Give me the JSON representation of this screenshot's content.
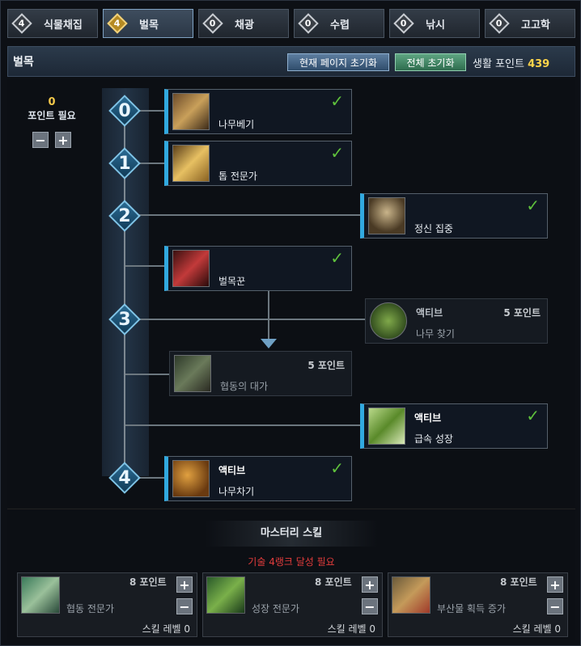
{
  "tabs": [
    {
      "num": "4",
      "label": "식물채집"
    },
    {
      "num": "4",
      "label": "벌목"
    },
    {
      "num": "0",
      "label": "채광"
    },
    {
      "num": "0",
      "label": "수렵"
    },
    {
      "num": "0",
      "label": "낚시"
    },
    {
      "num": "0",
      "label": "고고학"
    }
  ],
  "header": {
    "title": "벌목",
    "reset_page": "현재 페이지 초기화",
    "reset_all": "전체 초기화",
    "life_points_label": "생활 포인트",
    "life_points_value": "439"
  },
  "left": {
    "points": "0",
    "points_label": "포인트 필요",
    "minus": "−",
    "plus": "+"
  },
  "ranks": [
    "0",
    "1",
    "2",
    "3",
    "4"
  ],
  "nodes": {
    "logging": {
      "name": "나무베기",
      "check": "✓"
    },
    "axe": {
      "name": "톱 전문가",
      "check": "✓"
    },
    "focus": {
      "name": "정신 집중",
      "check": "✓"
    },
    "lumberjack": {
      "name": "벌목꾼",
      "check": "✓"
    },
    "findtree": {
      "type": "액티브",
      "points": "5 포인트",
      "name": "나무 찾기"
    },
    "coop": {
      "points": "5 포인트",
      "name": "협동의 대가"
    },
    "growth": {
      "type": "액티브",
      "name": "급속 성장",
      "check": "✓"
    },
    "chop": {
      "type": "액티브",
      "name": "나무차기",
      "check": "✓"
    }
  },
  "mastery": {
    "title": "마스터리 스킬",
    "requirement": "기술 4랭크 달성 필요",
    "cards": [
      {
        "points": "8 포인트",
        "name": "협동 전문가",
        "level": "스킬 레벨 0"
      },
      {
        "points": "8 포인트",
        "name": "성장 전문가",
        "level": "스킬 레벨 0"
      },
      {
        "points": "8 포인트",
        "name": "부산물 획득 증가",
        "level": "스킬 레벨 0"
      }
    ],
    "plus": "+",
    "minus": "−"
  }
}
